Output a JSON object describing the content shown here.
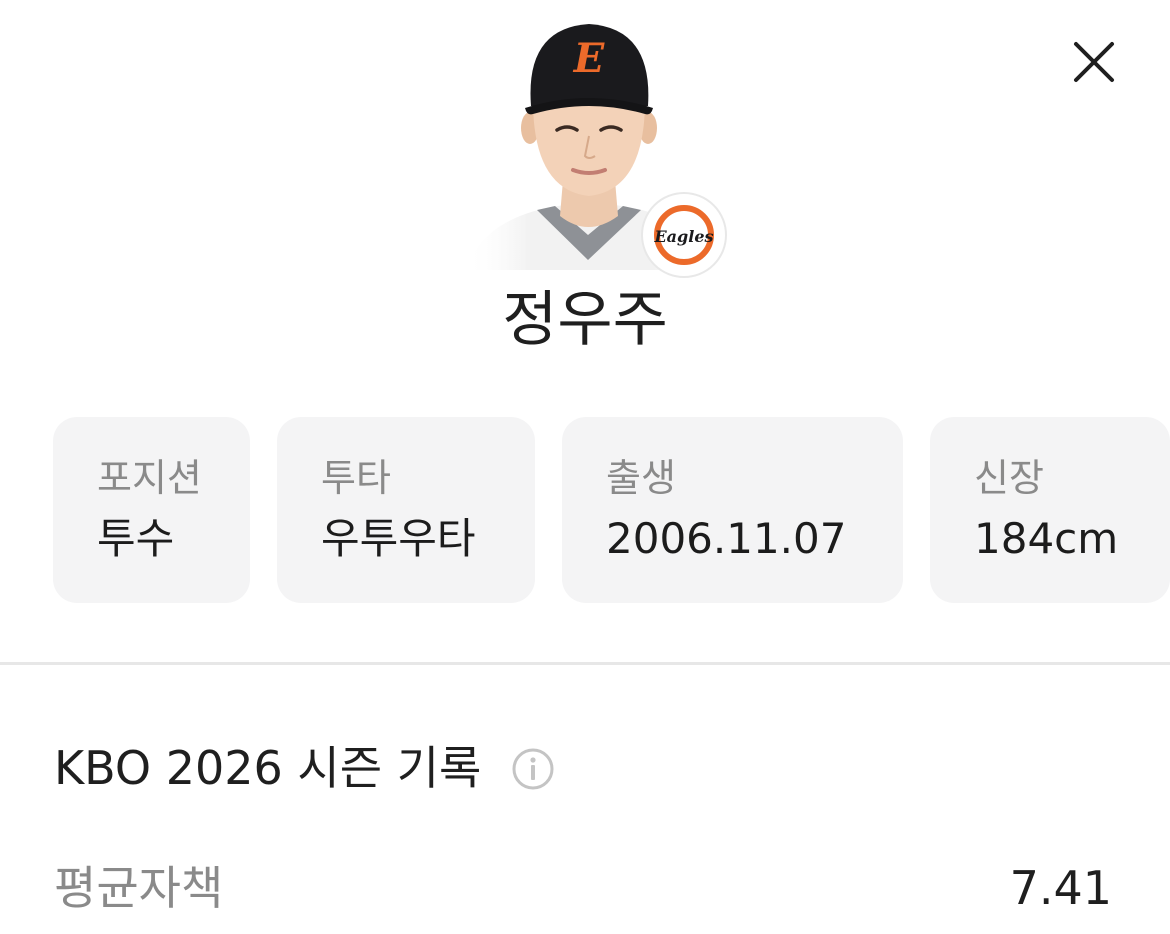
{
  "header": {
    "close_icon": "close-icon"
  },
  "player": {
    "name": "정우주",
    "photo_icon": "player-photo",
    "team_logo_text": "Eagles",
    "cap_letter": "E"
  },
  "info_cards": [
    {
      "label": "포지션",
      "value": "투수"
    },
    {
      "label": "투타",
      "value": "우투우타"
    },
    {
      "label": "출생",
      "value": "2006.11.07"
    },
    {
      "label": "신장",
      "value": "184cm"
    }
  ],
  "season": {
    "title": "KBO 2026 시즌 기록",
    "info_icon": "info-icon",
    "stats": [
      {
        "label": "평균자책",
        "value": "7.41"
      }
    ]
  },
  "colors": {
    "card_bg": "#f4f4f5",
    "label_gray": "#8a8a8a",
    "text_dark": "#1f1f1f",
    "team_orange": "#ec6a2a"
  }
}
